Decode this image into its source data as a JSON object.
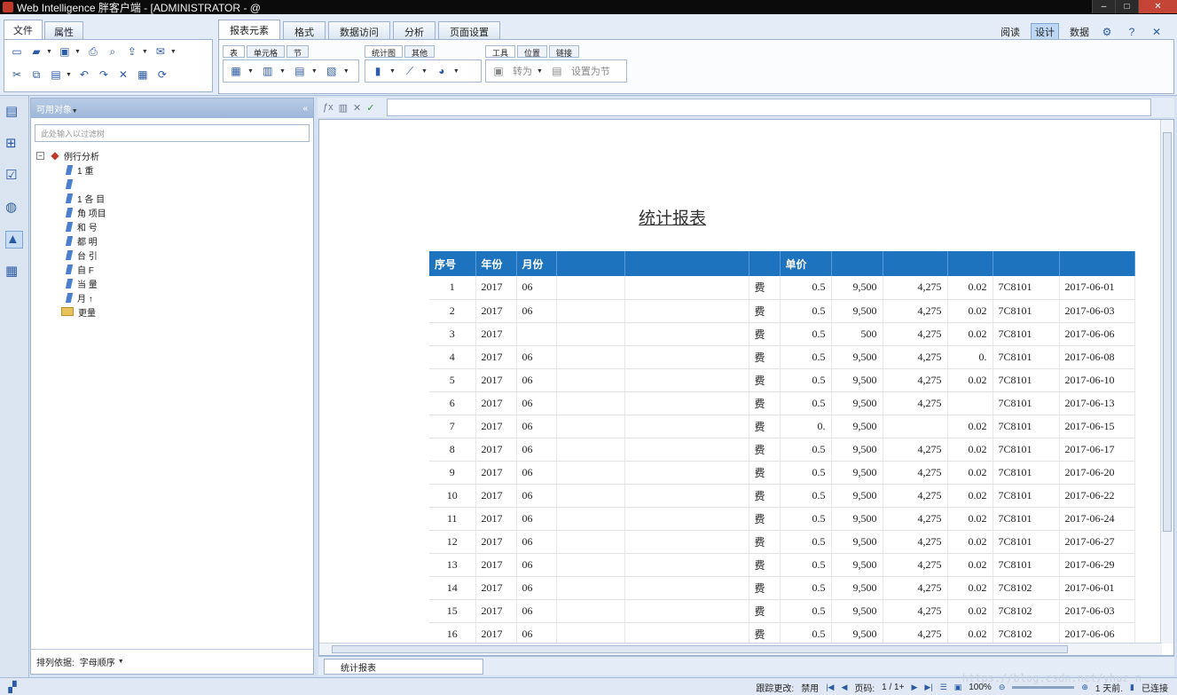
{
  "window": {
    "title": "Web Intelligence 胖客户端 - [ADMINISTRATOR - @"
  },
  "left_panel": {
    "tabs": [
      "文件",
      "属性"
    ]
  },
  "ribbon": {
    "tabs": [
      "报表元素",
      "格式",
      "数据访问",
      "分析",
      "页面设置"
    ],
    "view_modes": {
      "read": "阅读",
      "design": "设计",
      "data": "数据"
    },
    "groups": {
      "table": {
        "tabs": [
          "表",
          "单元格",
          "节"
        ]
      },
      "chart": {
        "tabs": [
          "统计图",
          "其他"
        ]
      },
      "tools": {
        "tabs": [
          "工具",
          "位置",
          "链接"
        ],
        "turn_into": "转为",
        "set_as_section": "设置为节"
      }
    }
  },
  "objects_panel": {
    "header": "可用对象",
    "filter_placeholder": "此处输入以过滤树",
    "tree": {
      "root": "例行分析",
      "children": [
        "1 重",
        "",
        "1 各 目",
        "角 项目",
        "和 号",
        "都 明",
        "台 引",
        "自 F",
        "当 量",
        "月 ↑"
      ],
      "folder": "更量"
    },
    "sort_label": "排列依据:",
    "sort_value": "字母顺序"
  },
  "report": {
    "title": "统计报表",
    "columns": [
      "序号",
      "年份",
      "月份",
      "",
      "",
      "",
      "单价",
      "",
      "",
      "",
      ""
    ],
    "rows": [
      [
        "1",
        "2017",
        "06",
        "",
        "",
        "费",
        "0.5",
        "9,500",
        "4,275",
        "0.02",
        "7C8101",
        "2017-06-01"
      ],
      [
        "2",
        "2017",
        "06",
        "",
        "",
        "费",
        "0.5",
        "9,500",
        "4,275",
        "0.02",
        "7C8101",
        "2017-06-03"
      ],
      [
        "3",
        "2017",
        "",
        "",
        "",
        "费",
        "0.5",
        "500",
        "4,275",
        "0.02",
        "7C8101",
        "2017-06-06"
      ],
      [
        "4",
        "2017",
        "06",
        "",
        "",
        "费",
        "0.5",
        "9,500",
        "4,275",
        "0.",
        "7C8101",
        "2017-06-08"
      ],
      [
        "5",
        "2017",
        "06",
        "",
        "",
        "费",
        "0.5",
        "9,500",
        "4,275",
        "0.02",
        "7C8101",
        "2017-06-10"
      ],
      [
        "6",
        "2017",
        "06",
        "",
        "",
        "费",
        "0.5",
        "9,500",
        "4,275",
        "",
        "7C8101",
        "2017-06-13"
      ],
      [
        "7",
        "2017",
        "06",
        "",
        "",
        "费",
        "0.",
        "9,500",
        "",
        "0.02",
        "7C8101",
        "2017-06-15"
      ],
      [
        "8",
        "2017",
        "06",
        "",
        "",
        "费",
        "0.5",
        "9,500",
        "4,275",
        "0.02",
        "7C8101",
        "2017-06-17"
      ],
      [
        "9",
        "2017",
        "06",
        "",
        "",
        "费",
        "0.5",
        "9,500",
        "4,275",
        "0.02",
        "7C8101",
        "2017-06-20"
      ],
      [
        "10",
        "2017",
        "06",
        "",
        "",
        "费",
        "0.5",
        "9,500",
        "4,275",
        "0.02",
        "7C8101",
        "2017-06-22"
      ],
      [
        "11",
        "2017",
        "06",
        "",
        "",
        "费",
        "0.5",
        "9,500",
        "4,275",
        "0.02",
        "7C8101",
        "2017-06-24"
      ],
      [
        "12",
        "2017",
        "06",
        "",
        "",
        "费",
        "0.5",
        "9,500",
        "4,275",
        "0.02",
        "7C8101",
        "2017-06-27"
      ],
      [
        "13",
        "2017",
        "06",
        "",
        "",
        "费",
        "0.5",
        "9,500",
        "4,275",
        "0.02",
        "7C8101",
        "2017-06-29"
      ],
      [
        "14",
        "2017",
        "06",
        "",
        "",
        "费",
        "0.5",
        "9,500",
        "4,275",
        "0.02",
        "7C8102",
        "2017-06-01"
      ],
      [
        "15",
        "2017",
        "06",
        "",
        "",
        "费",
        "0.5",
        "9,500",
        "4,275",
        "0.02",
        "7C8102",
        "2017-06-03"
      ],
      [
        "16",
        "2017",
        "06",
        "",
        "",
        "费",
        "0.5",
        "9,500",
        "4,275",
        "0.02",
        "7C8102",
        "2017-06-06"
      ]
    ]
  },
  "sheet": {
    "tab_label": "统计报表"
  },
  "status": {
    "tracking_label": "跟踪更改:",
    "tracking_value": "禁用",
    "page_label": "页码:",
    "page_value": "1 / 1+",
    "zoom": "100%",
    "last_refresh": "1 天前.",
    "connection": "已连接",
    "watermark": "https://blog.csdn.net/yhuz_n"
  },
  "colors": {
    "header_blue": "#1e73be",
    "ribbon_bg": "#e4ecf7"
  }
}
